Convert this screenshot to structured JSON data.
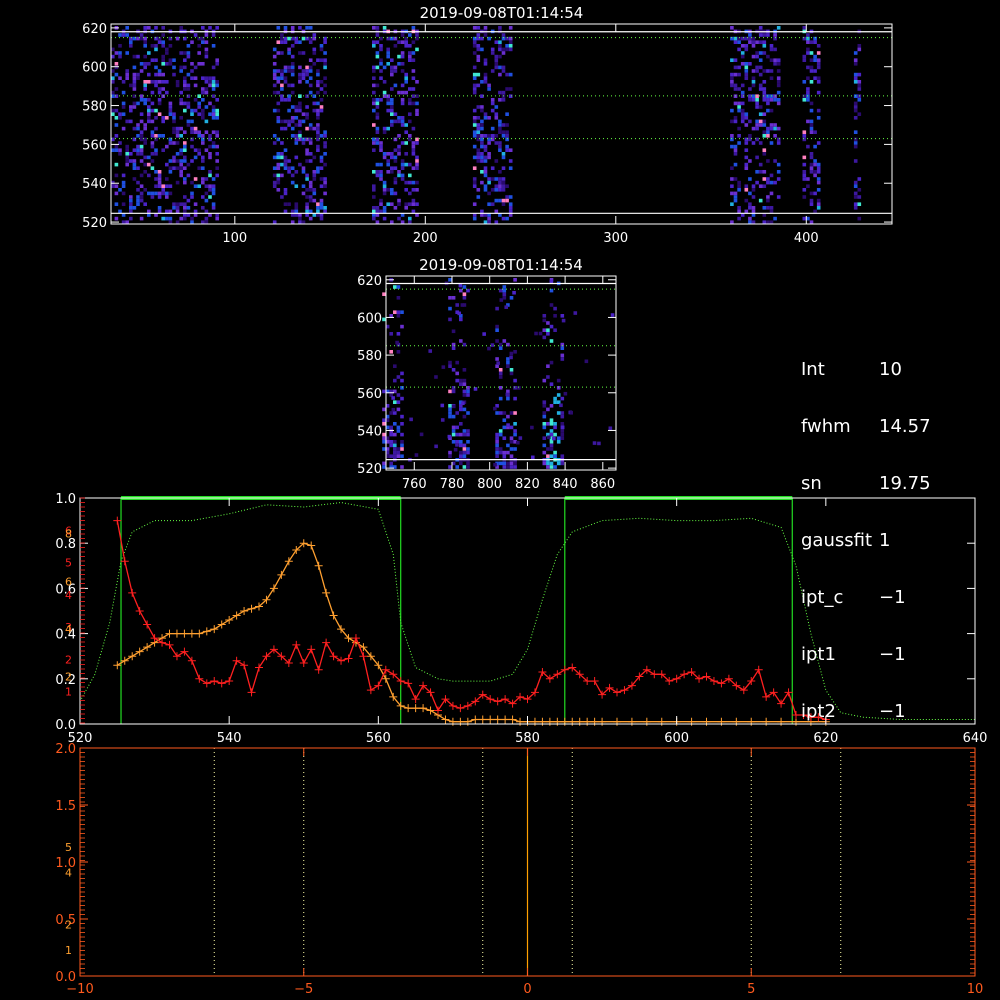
{
  "colors": {
    "background": "#000000",
    "axis": "#ffffff",
    "lower_axis": "#ff5a1e",
    "green_line": "#22dd22",
    "dotted_transmission": "#66ff44",
    "series_red": "#ff2020",
    "series_orange": "#ffa030",
    "zero_line": "#ffa000"
  },
  "info_panel": {
    "rows": [
      {
        "key": "Int",
        "value": "10"
      },
      {
        "key": "fwhm",
        "value": "14.57"
      },
      {
        "key": "sn",
        "value": "19.75"
      },
      {
        "key": "gaussfit",
        "value": "1"
      },
      {
        "key": "ipt_c",
        "value": "−1"
      },
      {
        "key": "ipt1",
        "value": "−1"
      },
      {
        "key": "ipt2",
        "value": "−1"
      }
    ]
  },
  "chart_data": [
    {
      "type": "heatmap",
      "title": "2019-09-08T01:14:54",
      "xlim": [
        35,
        445
      ],
      "ylim": [
        519,
        622
      ],
      "x_ticks": [
        "100",
        "200",
        "300",
        "400"
      ],
      "x_tick_values": [
        100,
        200,
        300,
        400
      ],
      "y_ticks": [
        "520",
        "540",
        "560",
        "580",
        "600",
        "620"
      ],
      "y_tick_values": [
        520,
        540,
        560,
        580,
        600,
        620
      ],
      "white_lines_y": [
        618,
        524.5
      ],
      "dotted_lines_y": [
        615,
        585,
        563
      ],
      "bands_x": [
        [
          35,
          90
        ],
        [
          120,
          148
        ],
        [
          172,
          196
        ],
        [
          225,
          245
        ],
        [
          360,
          386
        ],
        [
          398,
          406
        ],
        [
          425,
          428
        ]
      ]
    },
    {
      "type": "heatmap",
      "title": "2019-09-08T01:14:54",
      "xlim": [
        745,
        867
      ],
      "ylim": [
        519,
        622
      ],
      "x_ticks": [
        "760",
        "780",
        "800",
        "820",
        "840",
        "860"
      ],
      "x_tick_values": [
        760,
        780,
        800,
        820,
        840,
        860
      ],
      "y_ticks": [
        "520",
        "540",
        "560",
        "580",
        "600",
        "620"
      ],
      "y_tick_values": [
        520,
        540,
        560,
        580,
        600,
        620
      ],
      "white_lines_y": [
        618,
        524.5
      ],
      "dotted_lines_y": [
        615,
        585,
        563
      ],
      "hot_columns_x": [
        748,
        783,
        808,
        833
      ]
    },
    {
      "type": "line",
      "xlim": [
        520,
        640
      ],
      "ylim": [
        0,
        1.0
      ],
      "x_ticks": [
        "520",
        "540",
        "560",
        "580",
        "600",
        "620",
        "640"
      ],
      "x_tick_values": [
        520,
        540,
        560,
        580,
        600,
        620,
        640
      ],
      "y_ticks_left": [
        "0.0",
        "0.2",
        "0.4",
        "0.6",
        "0.8",
        "1.0"
      ],
      "y_tick_values_left": [
        0,
        0.2,
        0.4,
        0.6,
        0.8,
        1.0
      ],
      "y_ticks_right_red": [
        "1",
        "2",
        "3",
        "4",
        "5",
        "6"
      ],
      "y_tick_values_right_red": [
        1,
        2,
        3,
        4,
        5,
        6
      ],
      "y_ticks_right_orange": [
        "2",
        "4",
        "6",
        "8"
      ],
      "y_tick_values_right_orange": [
        2,
        4,
        6,
        8
      ],
      "green_boxes": [
        [
          525.5,
          563
        ],
        [
          585,
          615.5
        ]
      ],
      "series": [
        {
          "style": "dotted",
          "color_key": "dotted_transmission",
          "x": [
            520,
            522,
            524,
            525.5,
            527,
            530,
            535,
            540,
            545,
            550,
            555,
            560,
            562,
            563,
            565,
            568,
            570,
            575,
            578,
            580,
            582,
            584,
            586,
            590,
            595,
            600,
            605,
            610,
            614,
            616,
            618,
            620,
            622,
            625,
            630,
            635,
            640
          ],
          "y": [
            0.1,
            0.22,
            0.45,
            0.72,
            0.85,
            0.9,
            0.9,
            0.93,
            0.97,
            0.96,
            0.98,
            0.95,
            0.75,
            0.45,
            0.25,
            0.2,
            0.19,
            0.19,
            0.22,
            0.33,
            0.55,
            0.75,
            0.85,
            0.9,
            0.91,
            0.9,
            0.9,
            0.91,
            0.87,
            0.7,
            0.4,
            0.15,
            0.05,
            0.03,
            0.02,
            0.02,
            0.02
          ]
        },
        {
          "style": "line+cross",
          "color_key": "series_orange",
          "x": [
            525,
            526,
            527,
            528,
            529,
            530,
            531,
            532,
            533,
            534,
            535,
            536,
            537,
            538,
            539,
            540,
            541,
            542,
            543,
            544,
            545,
            546,
            547,
            548,
            549,
            550,
            551,
            552,
            553,
            554,
            555,
            556,
            557,
            558,
            559,
            560,
            561,
            562,
            563,
            564,
            565,
            566,
            567,
            568,
            569,
            570,
            571,
            572,
            573,
            574,
            575,
            576,
            577,
            578,
            579,
            580,
            581,
            582,
            583,
            584,
            585,
            586,
            587,
            588,
            589,
            590,
            592,
            594,
            596,
            598,
            600,
            602,
            604,
            606,
            608,
            610,
            612,
            614,
            616,
            618,
            620
          ],
          "y": [
            0.26,
            0.28,
            0.3,
            0.32,
            0.34,
            0.36,
            0.38,
            0.4,
            0.4,
            0.4,
            0.4,
            0.4,
            0.41,
            0.42,
            0.44,
            0.46,
            0.48,
            0.5,
            0.51,
            0.52,
            0.55,
            0.6,
            0.66,
            0.72,
            0.77,
            0.8,
            0.79,
            0.7,
            0.58,
            0.48,
            0.42,
            0.38,
            0.36,
            0.34,
            0.3,
            0.26,
            0.2,
            0.12,
            0.08,
            0.07,
            0.07,
            0.07,
            0.06,
            0.04,
            0.02,
            0.01,
            0.01,
            0.01,
            0.02,
            0.02,
            0.02,
            0.02,
            0.02,
            0.02,
            0.01,
            0.01,
            0.01,
            0.01,
            0.01,
            0.01,
            0.01,
            0.01,
            0.01,
            0.01,
            0.01,
            0.01,
            0.01,
            0.01,
            0.01,
            0.01,
            0.01,
            0.01,
            0.01,
            0.01,
            0.01,
            0.01,
            0.01,
            0.01,
            0.01,
            0.01,
            0.01
          ]
        },
        {
          "style": "line+cross",
          "color_key": "series_red",
          "x": [
            525,
            526,
            527,
            528,
            529,
            530,
            531,
            532,
            533,
            534,
            535,
            536,
            537,
            538,
            539,
            540,
            541,
            542,
            543,
            544,
            545,
            546,
            547,
            548,
            549,
            550,
            551,
            552,
            553,
            554,
            555,
            556,
            557,
            558,
            559,
            560,
            561,
            562,
            563,
            564,
            565,
            566,
            567,
            568,
            569,
            570,
            571,
            572,
            573,
            574,
            575,
            576,
            577,
            578,
            579,
            580,
            581,
            582,
            583,
            584,
            585,
            586,
            587,
            588,
            589,
            590,
            591,
            592,
            593,
            594,
            595,
            596,
            597,
            598,
            599,
            600,
            601,
            602,
            603,
            604,
            605,
            606,
            607,
            608,
            609,
            610,
            611,
            612,
            613,
            614,
            615,
            616,
            617,
            618,
            619,
            620
          ],
          "y": [
            0.9,
            0.72,
            0.58,
            0.5,
            0.44,
            0.38,
            0.36,
            0.35,
            0.3,
            0.32,
            0.28,
            0.2,
            0.18,
            0.19,
            0.18,
            0.19,
            0.28,
            0.26,
            0.14,
            0.25,
            0.3,
            0.33,
            0.3,
            0.27,
            0.35,
            0.27,
            0.33,
            0.24,
            0.36,
            0.3,
            0.28,
            0.29,
            0.38,
            0.3,
            0.15,
            0.17,
            0.24,
            0.22,
            0.19,
            0.18,
            0.11,
            0.17,
            0.14,
            0.06,
            0.11,
            0.08,
            0.07,
            0.08,
            0.1,
            0.13,
            0.11,
            0.1,
            0.11,
            0.09,
            0.12,
            0.11,
            0.14,
            0.23,
            0.2,
            0.22,
            0.24,
            0.25,
            0.22,
            0.19,
            0.19,
            0.13,
            0.16,
            0.14,
            0.15,
            0.17,
            0.21,
            0.24,
            0.22,
            0.22,
            0.19,
            0.2,
            0.22,
            0.23,
            0.2,
            0.21,
            0.19,
            0.18,
            0.2,
            0.17,
            0.15,
            0.19,
            0.24,
            0.12,
            0.14,
            0.09,
            0.14,
            0.04,
            0.04,
            0.03,
            0.03,
            0.02
          ]
        }
      ]
    },
    {
      "type": "line",
      "xlim": [
        -10,
        10
      ],
      "ylim": [
        0,
        2.0
      ],
      "x_ticks": [
        "−10",
        "−5",
        "0",
        "5",
        "10"
      ],
      "x_tick_values": [
        -10,
        -5,
        0,
        5,
        10
      ],
      "y_ticks_left": [
        "0.0",
        "0.5",
        "1.0",
        "1.5",
        "2.0"
      ],
      "y_tick_values_left": [
        0,
        0.5,
        1.0,
        1.5,
        2.0
      ],
      "y_ticks_left_extra": [
        "1",
        "2",
        "4",
        "5"
      ],
      "y_tick_values_left_extra": [
        0.23,
        0.45,
        0.91,
        1.13
      ],
      "dotted_vlines_x": [
        -7,
        -5,
        -1,
        1,
        5,
        7
      ],
      "zero_line_x": 0
    }
  ]
}
